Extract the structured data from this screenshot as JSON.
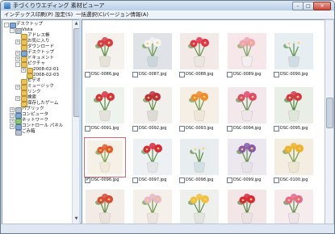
{
  "window": {
    "title": "手づくりウエディング 素材ビューア"
  },
  "menu": [
    "インデックス印刷(P)",
    "設定(S)",
    "一括選択(C)",
    "バージョン情報(A)"
  ],
  "tree": [
    {
      "label": "デスクトップ",
      "level": 0,
      "toggle": "-",
      "icon": "blue"
    },
    {
      "label": "Vista",
      "level": 1,
      "toggle": "-",
      "icon": "gray"
    },
    {
      "label": "アドレス帳",
      "level": 2,
      "toggle": "",
      "icon": "yellow"
    },
    {
      "label": "お気に入り",
      "level": 2,
      "toggle": "+",
      "icon": "yellow"
    },
    {
      "label": "ダウンロード",
      "level": 2,
      "toggle": "",
      "icon": "yellow"
    },
    {
      "label": "デスクトップ",
      "level": 2,
      "toggle": "+",
      "icon": "blue"
    },
    {
      "label": "ドキュメント",
      "level": 2,
      "toggle": "+",
      "icon": "yellow"
    },
    {
      "label": "ピクチャ",
      "level": 2,
      "toggle": "-",
      "icon": "yellow"
    },
    {
      "label": "2008-02-01",
      "level": 3,
      "toggle": "+",
      "icon": "yellow"
    },
    {
      "label": "2008-02-03",
      "level": 3,
      "toggle": "",
      "icon": "yellow"
    },
    {
      "label": "ビデオ",
      "level": 2,
      "toggle": "",
      "icon": "yellow"
    },
    {
      "label": "ミュージック",
      "level": 2,
      "toggle": "+",
      "icon": "yellow"
    },
    {
      "label": "リンク",
      "level": 2,
      "toggle": "",
      "icon": "yellow"
    },
    {
      "label": "検索",
      "level": 2,
      "toggle": "+",
      "icon": "yellow"
    },
    {
      "label": "保存したゲーム",
      "level": 2,
      "toggle": "",
      "icon": "yellow"
    },
    {
      "label": "パブリック",
      "level": 1,
      "toggle": "+",
      "icon": "gray"
    },
    {
      "label": "コンピュータ",
      "level": 1,
      "toggle": "+",
      "icon": "blue"
    },
    {
      "label": "ネットワーク",
      "level": 1,
      "toggle": "+",
      "icon": "green"
    },
    {
      "label": "コントロール パネル",
      "level": 1,
      "toggle": "+",
      "icon": "blue"
    },
    {
      "label": "ごみ箱",
      "level": 1,
      "toggle": "",
      "icon": "gray"
    }
  ],
  "thumbnails": [
    {
      "name": "DSC-0086.jpg",
      "bg": "#f5f2ee",
      "flower": "#d83a48",
      "vase": "#e6e2da",
      "leaf": "#5b8f3e",
      "checked": false
    },
    {
      "name": "DSC-0087.jpg",
      "bg": "#dfe3e8",
      "flower": "#f4f4f2",
      "vase": "#c9d6dd",
      "leaf": "#6a9a48",
      "checked": false
    },
    {
      "name": "DSC-0088.jpg",
      "bg": "#f3e9e6",
      "flower": "#e2324a",
      "vase": "#ece6e0",
      "leaf": "#63944a",
      "checked": false
    },
    {
      "name": "DSC-0089.jpg",
      "bg": "#f6e7ea",
      "flower": "#f0a3b3",
      "vase": "#f3eef0",
      "leaf": "#7aa35c",
      "checked": false
    },
    {
      "name": "DSC-0090.jpg",
      "bg": "#e6eef2",
      "flower": "#e8eef3",
      "vase": "#cfdde6",
      "leaf": "#5d9147",
      "checked": false
    },
    {
      "name": "DSC-0091.jpg",
      "bg": "#eef3ee",
      "flower": "#d8323e",
      "vase": "#e3e3dc",
      "leaf": "#558a3a",
      "checked": false
    },
    {
      "name": "DSC-0092.jpg",
      "bg": "#f1f0ec",
      "flower": "#c22b3a",
      "vase": "#dcdcd4",
      "leaf": "#5f9342",
      "checked": false
    },
    {
      "name": "DSC-0093.jpg",
      "bg": "#f5efe6",
      "flower": "#f08a2a",
      "vase": "#efe7da",
      "leaf": "#6a9b48",
      "checked": false
    },
    {
      "name": "DSC-0094.jpg",
      "bg": "#f3e8ec",
      "flower": "#e04a6a",
      "vase": "#efe6ea",
      "leaf": "#5e8f45",
      "checked": false
    },
    {
      "name": "DSC-0095.jpg",
      "bg": "#e9efe6",
      "flower": "#d4384a",
      "vase": "#dfe6da",
      "leaf": "#4f8a3a",
      "checked": false
    },
    {
      "name": "DSC-0096.jpg",
      "bg": "#f6f1e6",
      "flower": "#e05a2e",
      "vase": "#f1e9d8",
      "leaf": "#6a9c45",
      "checked": true
    },
    {
      "name": "DSC-0097.jpg",
      "bg": "#eef1f3",
      "flower": "#d9283a",
      "vase": "#e2e6e8",
      "leaf": "#5a8f42",
      "checked": false
    },
    {
      "name": "DSC-0098.jpg",
      "bg": "#e8eef0",
      "flower": "#e8ecef",
      "vase": "#d4dfe4",
      "leaf": "#5e9045",
      "checked": false
    },
    {
      "name": "DSC-0099.jpg",
      "bg": "#ece8ef",
      "flower": "#8a5aa8",
      "vase": "#e6e2ea",
      "leaf": "#5d8f43",
      "checked": false
    },
    {
      "name": "DSC-0100.jpg",
      "bg": "#f4eee2",
      "flower": "#f0b02a",
      "vase": "#eee6d4",
      "leaf": "#6b9b45",
      "checked": false
    },
    {
      "name": "",
      "bg": "#f3ece6",
      "flower": "#d94a3a",
      "vase": "#ece4dc",
      "leaf": "#5c8f42",
      "checked": false
    },
    {
      "name": "",
      "bg": "#f5f0ea",
      "flower": "#e6b8c8",
      "vase": "#ede6e0",
      "leaf": "#6a9a48",
      "checked": false
    },
    {
      "name": "",
      "bg": "#eef0ee",
      "flower": "#f2c040",
      "vase": "#e2e4de",
      "leaf": "#5e9145",
      "checked": false
    },
    {
      "name": "",
      "bg": "#f2e6e6",
      "flower": "#d8283a",
      "vase": "#ece2e2",
      "leaf": "#588a40",
      "checked": false
    },
    {
      "name": "",
      "bg": "#f6ecee",
      "flower": "#e56a8a",
      "vase": "#efe4e8",
      "leaf": "#5f9044",
      "checked": false
    }
  ]
}
